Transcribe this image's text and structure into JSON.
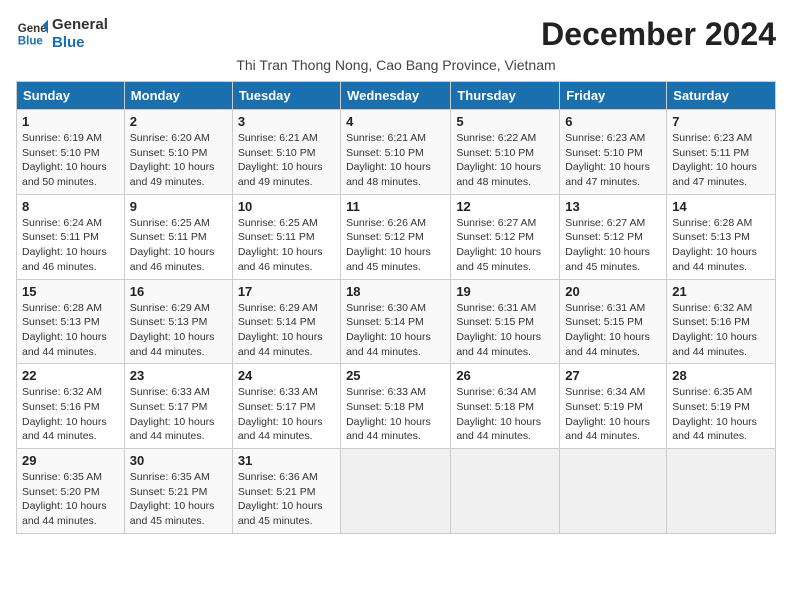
{
  "logo": {
    "line1": "General",
    "line2": "Blue"
  },
  "title": "December 2024",
  "subtitle": "Thi Tran Thong Nong, Cao Bang Province, Vietnam",
  "days_of_week": [
    "Sunday",
    "Monday",
    "Tuesday",
    "Wednesday",
    "Thursday",
    "Friday",
    "Saturday"
  ],
  "weeks": [
    [
      {
        "day": "1",
        "info": "Sunrise: 6:19 AM\nSunset: 5:10 PM\nDaylight: 10 hours\nand 50 minutes."
      },
      {
        "day": "2",
        "info": "Sunrise: 6:20 AM\nSunset: 5:10 PM\nDaylight: 10 hours\nand 49 minutes."
      },
      {
        "day": "3",
        "info": "Sunrise: 6:21 AM\nSunset: 5:10 PM\nDaylight: 10 hours\nand 49 minutes."
      },
      {
        "day": "4",
        "info": "Sunrise: 6:21 AM\nSunset: 5:10 PM\nDaylight: 10 hours\nand 48 minutes."
      },
      {
        "day": "5",
        "info": "Sunrise: 6:22 AM\nSunset: 5:10 PM\nDaylight: 10 hours\nand 48 minutes."
      },
      {
        "day": "6",
        "info": "Sunrise: 6:23 AM\nSunset: 5:10 PM\nDaylight: 10 hours\nand 47 minutes."
      },
      {
        "day": "7",
        "info": "Sunrise: 6:23 AM\nSunset: 5:11 PM\nDaylight: 10 hours\nand 47 minutes."
      }
    ],
    [
      {
        "day": "8",
        "info": "Sunrise: 6:24 AM\nSunset: 5:11 PM\nDaylight: 10 hours\nand 46 minutes."
      },
      {
        "day": "9",
        "info": "Sunrise: 6:25 AM\nSunset: 5:11 PM\nDaylight: 10 hours\nand 46 minutes."
      },
      {
        "day": "10",
        "info": "Sunrise: 6:25 AM\nSunset: 5:11 PM\nDaylight: 10 hours\nand 46 minutes."
      },
      {
        "day": "11",
        "info": "Sunrise: 6:26 AM\nSunset: 5:12 PM\nDaylight: 10 hours\nand 45 minutes."
      },
      {
        "day": "12",
        "info": "Sunrise: 6:27 AM\nSunset: 5:12 PM\nDaylight: 10 hours\nand 45 minutes."
      },
      {
        "day": "13",
        "info": "Sunrise: 6:27 AM\nSunset: 5:12 PM\nDaylight: 10 hours\nand 45 minutes."
      },
      {
        "day": "14",
        "info": "Sunrise: 6:28 AM\nSunset: 5:13 PM\nDaylight: 10 hours\nand 44 minutes."
      }
    ],
    [
      {
        "day": "15",
        "info": "Sunrise: 6:28 AM\nSunset: 5:13 PM\nDaylight: 10 hours\nand 44 minutes."
      },
      {
        "day": "16",
        "info": "Sunrise: 6:29 AM\nSunset: 5:13 PM\nDaylight: 10 hours\nand 44 minutes."
      },
      {
        "day": "17",
        "info": "Sunrise: 6:29 AM\nSunset: 5:14 PM\nDaylight: 10 hours\nand 44 minutes."
      },
      {
        "day": "18",
        "info": "Sunrise: 6:30 AM\nSunset: 5:14 PM\nDaylight: 10 hours\nand 44 minutes."
      },
      {
        "day": "19",
        "info": "Sunrise: 6:31 AM\nSunset: 5:15 PM\nDaylight: 10 hours\nand 44 minutes."
      },
      {
        "day": "20",
        "info": "Sunrise: 6:31 AM\nSunset: 5:15 PM\nDaylight: 10 hours\nand 44 minutes."
      },
      {
        "day": "21",
        "info": "Sunrise: 6:32 AM\nSunset: 5:16 PM\nDaylight: 10 hours\nand 44 minutes."
      }
    ],
    [
      {
        "day": "22",
        "info": "Sunrise: 6:32 AM\nSunset: 5:16 PM\nDaylight: 10 hours\nand 44 minutes."
      },
      {
        "day": "23",
        "info": "Sunrise: 6:33 AM\nSunset: 5:17 PM\nDaylight: 10 hours\nand 44 minutes."
      },
      {
        "day": "24",
        "info": "Sunrise: 6:33 AM\nSunset: 5:17 PM\nDaylight: 10 hours\nand 44 minutes."
      },
      {
        "day": "25",
        "info": "Sunrise: 6:33 AM\nSunset: 5:18 PM\nDaylight: 10 hours\nand 44 minutes."
      },
      {
        "day": "26",
        "info": "Sunrise: 6:34 AM\nSunset: 5:18 PM\nDaylight: 10 hours\nand 44 minutes."
      },
      {
        "day": "27",
        "info": "Sunrise: 6:34 AM\nSunset: 5:19 PM\nDaylight: 10 hours\nand 44 minutes."
      },
      {
        "day": "28",
        "info": "Sunrise: 6:35 AM\nSunset: 5:19 PM\nDaylight: 10 hours\nand 44 minutes."
      }
    ],
    [
      {
        "day": "29",
        "info": "Sunrise: 6:35 AM\nSunset: 5:20 PM\nDaylight: 10 hours\nand 44 minutes."
      },
      {
        "day": "30",
        "info": "Sunrise: 6:35 AM\nSunset: 5:21 PM\nDaylight: 10 hours\nand 45 minutes."
      },
      {
        "day": "31",
        "info": "Sunrise: 6:36 AM\nSunset: 5:21 PM\nDaylight: 10 hours\nand 45 minutes."
      },
      {
        "day": "",
        "info": ""
      },
      {
        "day": "",
        "info": ""
      },
      {
        "day": "",
        "info": ""
      },
      {
        "day": "",
        "info": ""
      }
    ]
  ]
}
